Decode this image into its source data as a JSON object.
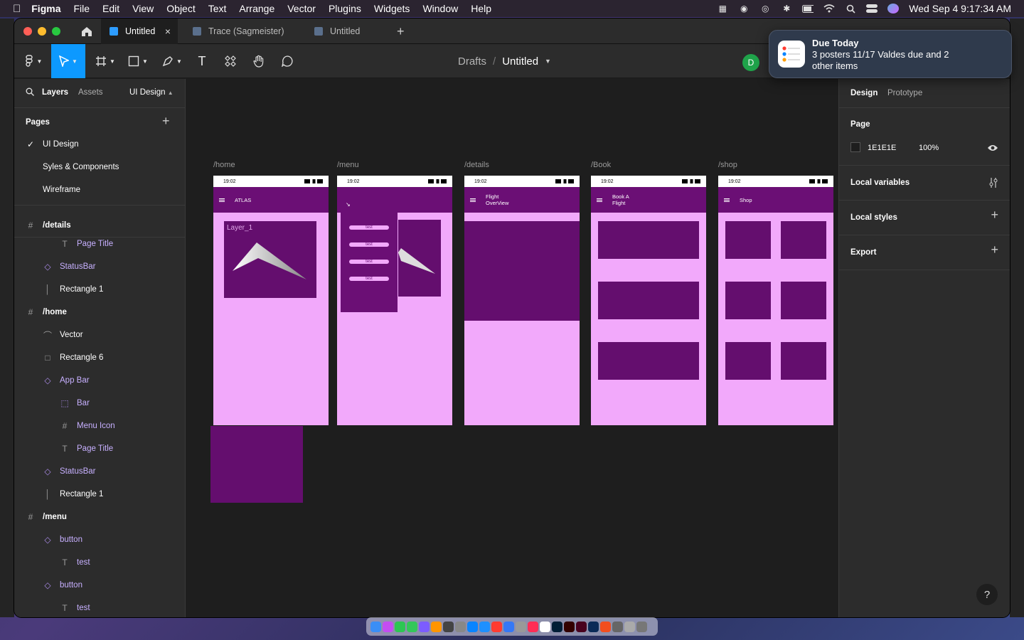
{
  "menubar": {
    "app": "Figma",
    "items": [
      "File",
      "Edit",
      "View",
      "Object",
      "Text",
      "Arrange",
      "Vector",
      "Plugins",
      "Widgets",
      "Window",
      "Help"
    ],
    "clock": "Wed Sep 4  9:17:34 AM"
  },
  "tabs": [
    {
      "label": "Untitled",
      "active": true
    },
    {
      "label": "Trace (Sagmeister)",
      "active": false
    },
    {
      "label": "Untitled",
      "active": false
    }
  ],
  "breadcrumb": {
    "parent": "Drafts",
    "sep": "/",
    "title": "Untitled"
  },
  "avatar": "D",
  "left": {
    "tab_layers": "Layers",
    "tab_assets": "Assets",
    "page_switch": "UI Design",
    "pages_title": "Pages",
    "pages": [
      "UI Design",
      "Syles & Components",
      "Wireframe"
    ],
    "layers": [
      {
        "label": "/details",
        "type": "frame"
      },
      {
        "label": "Page Title",
        "type": "text"
      },
      {
        "label": "StatusBar",
        "type": "component"
      },
      {
        "label": "Rectangle 1",
        "type": "rect-thin"
      },
      {
        "label": "/home",
        "type": "frame"
      },
      {
        "label": "Vector",
        "type": "vector"
      },
      {
        "label": "Rectangle 6",
        "type": "rect"
      },
      {
        "label": "App Bar",
        "type": "component"
      },
      {
        "label": "Bar",
        "type": "instance"
      },
      {
        "label": "Menu Icon",
        "type": "frame-small"
      },
      {
        "label": "Page Title",
        "type": "text"
      },
      {
        "label": "StatusBar",
        "type": "component"
      },
      {
        "label": "Rectangle 1",
        "type": "rect-thin"
      },
      {
        "label": "/menu",
        "type": "frame"
      },
      {
        "label": "button",
        "type": "component"
      },
      {
        "label": "test",
        "type": "text"
      },
      {
        "label": "button",
        "type": "component"
      },
      {
        "label": "test",
        "type": "text"
      }
    ]
  },
  "canvas": {
    "frames": [
      {
        "label": "/home",
        "title": "ATLAS",
        "time": "19:02"
      },
      {
        "label": "/menu",
        "title": "",
        "time": "19:02"
      },
      {
        "label": "/details",
        "title": "Flight\nOverView",
        "time": "19:02"
      },
      {
        "label": "/Book",
        "title": "Book A\nFlight",
        "time": "19:02"
      },
      {
        "label": "/shop",
        "title": "Shop",
        "time": "19:02"
      }
    ],
    "layer_tag": "Layer_1",
    "menu_buttons": [
      "test",
      "test",
      "test",
      "test"
    ]
  },
  "right": {
    "tab_design": "Design",
    "tab_proto": "Prototype",
    "page_title": "Page",
    "page_color": "1E1E1E",
    "page_opacity": "100%",
    "local_vars": "Local variables",
    "local_styles": "Local styles",
    "export": "Export"
  },
  "notification": {
    "title": "Due Today",
    "body": "3 posters 11/17 Valdes due and 2 other items"
  },
  "help": "?",
  "colors": {
    "frame_bg": "#f2a9fb",
    "frame_dark": "#640e6e",
    "accent": "#0d99ff",
    "avatar": "#1fa34a"
  }
}
